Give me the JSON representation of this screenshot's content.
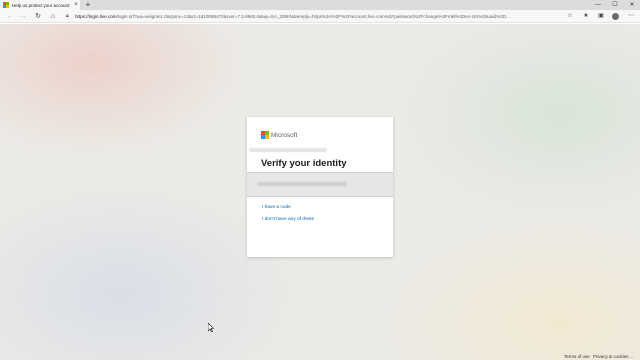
{
  "browser": {
    "tab_title": "Help us protect your account",
    "tab_close": "×",
    "new_tab": "+",
    "url_host": "https://login.live.com",
    "url_path": "/login.srf?wa=wsignin1.0&rpsnv=13&ct=1610088472&rver=7.3.6960.0&wp=SA_20MIN&wreply=https%3A%2F%2Faccount.live.com%2Fpassword%2Fchange%3Fmkt%3Den-US%26uaid%3D...",
    "window_minimize": "—",
    "window_maximize": "☐",
    "window_close": "✕"
  },
  "card": {
    "brand": "Microsoft",
    "heading": "Verify your identity",
    "link_have_code": "I have a code",
    "link_dont_have": "I don't have any of these"
  },
  "footer": {
    "terms": "Terms of use",
    "privacy": "Privacy & cookies",
    "more": "..."
  },
  "colors": {
    "ms_red": "#f25022",
    "ms_green": "#7fba00",
    "ms_blue": "#00a4ef",
    "ms_yellow": "#ffb900",
    "link": "#0067b8"
  }
}
